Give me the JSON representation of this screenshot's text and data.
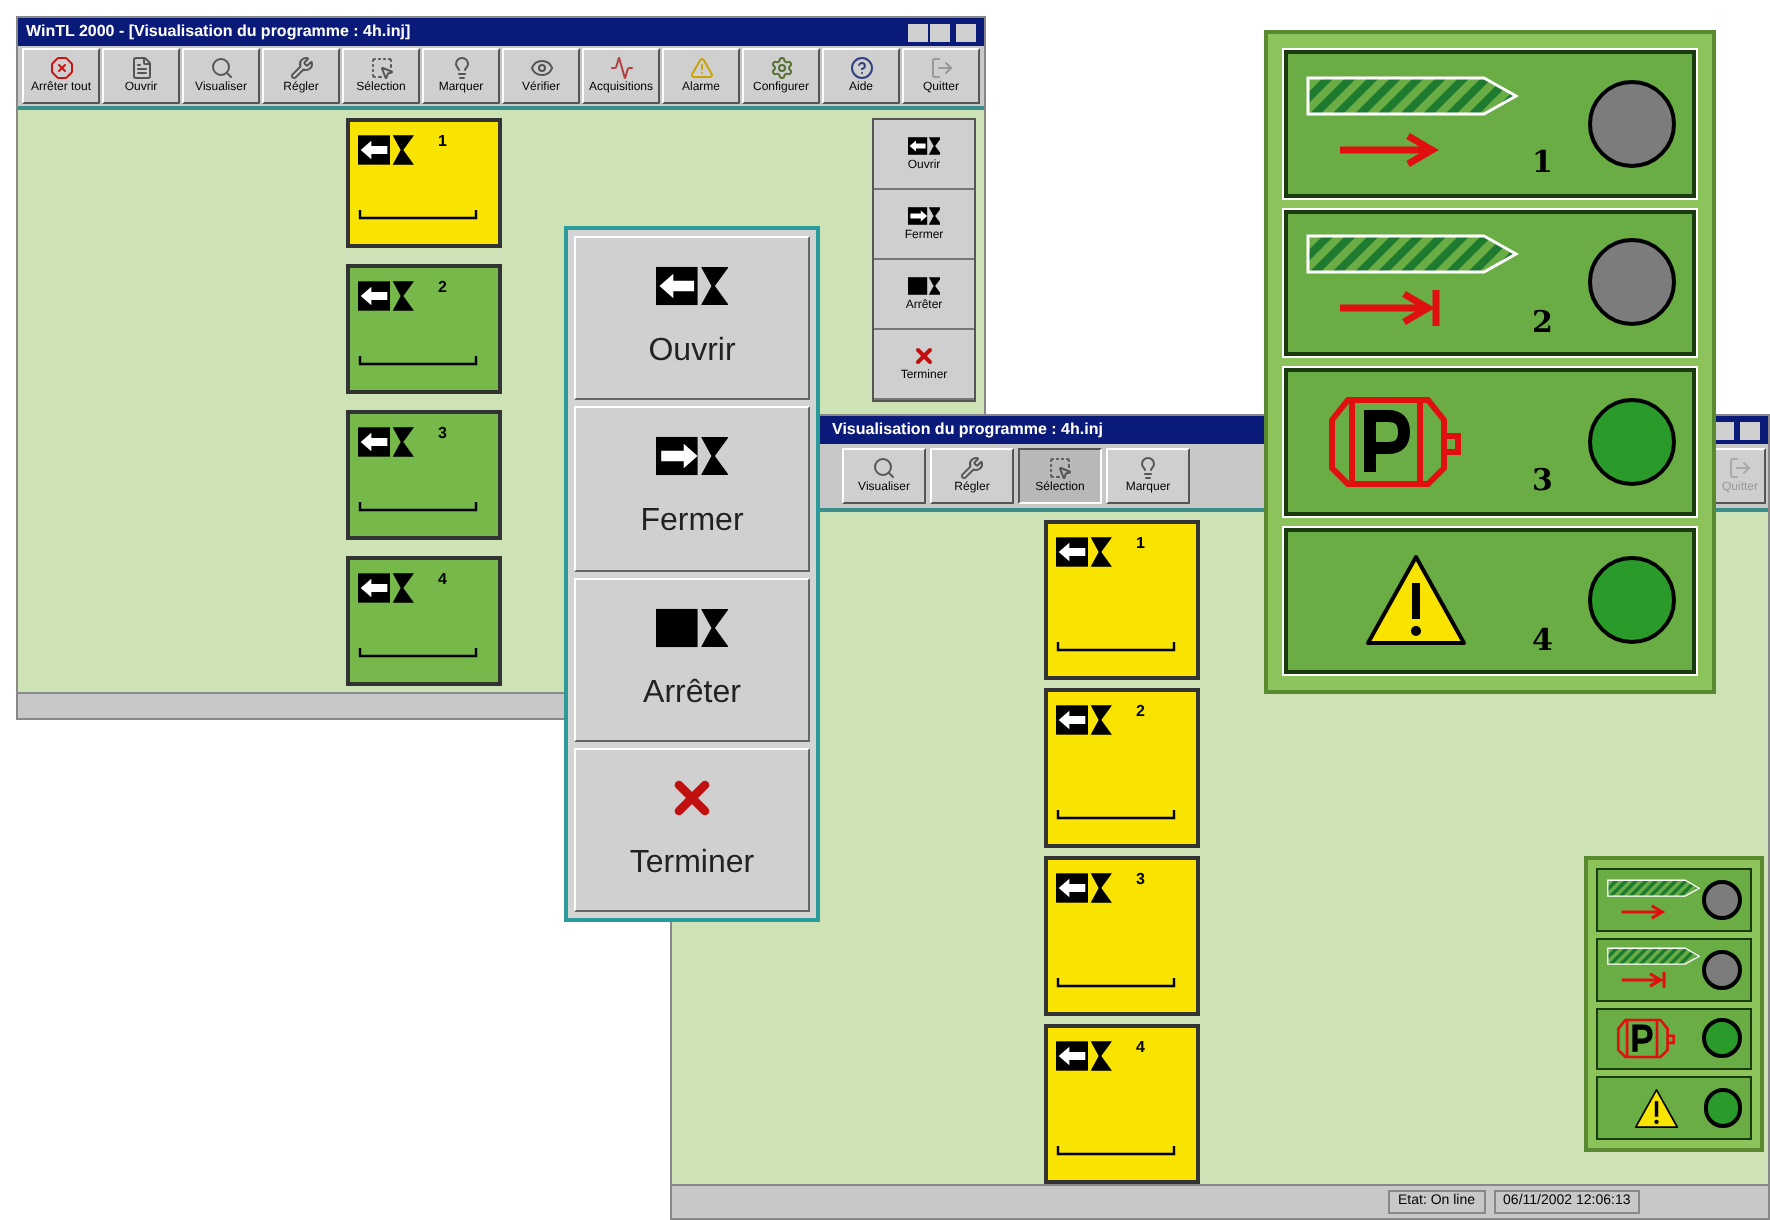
{
  "window_main": {
    "title": "WinTL 2000 - [Visualisation du programme : 4h.inj]",
    "toolbar": [
      {
        "label": "Arrêter tout",
        "selected": false
      },
      {
        "label": "Ouvrir",
        "selected": false
      },
      {
        "label": "Visualiser",
        "selected": false
      },
      {
        "label": "Régler",
        "selected": false
      },
      {
        "label": "Sélection",
        "selected": false
      },
      {
        "label": "Marquer",
        "selected": false
      },
      {
        "label": "Vérifier",
        "selected": false
      },
      {
        "label": "Acquisitions",
        "selected": false
      },
      {
        "label": "Alarme",
        "selected": false
      },
      {
        "label": "Configurer",
        "selected": false
      },
      {
        "label": "Aide",
        "selected": false
      },
      {
        "label": "Quitter",
        "selected": false
      }
    ],
    "programs": [
      {
        "number": "1",
        "active": true
      },
      {
        "number": "2",
        "active": false
      },
      {
        "number": "3",
        "active": false
      },
      {
        "number": "4",
        "active": false
      }
    ],
    "side_buttons": [
      {
        "label": "Ouvrir",
        "kind": "open"
      },
      {
        "label": "Fermer",
        "kind": "close"
      },
      {
        "label": "Arrêter",
        "kind": "stop"
      },
      {
        "label": "Terminer",
        "kind": "end"
      }
    ]
  },
  "window_second": {
    "title": "Visualisation du programme : 4h.inj",
    "toolbar": [
      {
        "label": "Visualiser",
        "selected": false
      },
      {
        "label": "Régler",
        "selected": false
      },
      {
        "label": "Sélection",
        "selected": true
      },
      {
        "label": "Marquer",
        "selected": false
      }
    ],
    "toolbar_right": {
      "label": "Quitter",
      "disabled": true
    },
    "programs": [
      {
        "number": "1",
        "active": true
      },
      {
        "number": "2",
        "active": true
      },
      {
        "number": "3",
        "active": true
      },
      {
        "number": "4",
        "active": true
      }
    ],
    "status_bar": [
      "Etat: On line",
      "06/11/2002 12:06:13"
    ]
  },
  "action_menu": [
    {
      "label": "Ouvrir",
      "kind": "open"
    },
    {
      "label": "Fermer",
      "kind": "close"
    },
    {
      "label": "Arrêter",
      "kind": "stop"
    },
    {
      "label": "Terminer",
      "kind": "end"
    }
  ],
  "status_panel": [
    {
      "kind": "moving",
      "number": "1",
      "lamp_on": false
    },
    {
      "kind": "stopping",
      "number": "2",
      "lamp_on": false
    },
    {
      "kind": "parked",
      "number": "3",
      "lamp_on": true
    },
    {
      "kind": "alarm",
      "number": "4",
      "lamp_on": true
    }
  ],
  "mini_panel": [
    {
      "kind": "moving",
      "lamp_on": false
    },
    {
      "kind": "stopping",
      "lamp_on": false
    },
    {
      "kind": "parked",
      "lamp_on": true
    },
    {
      "kind": "alarm",
      "lamp_on": true
    }
  ]
}
